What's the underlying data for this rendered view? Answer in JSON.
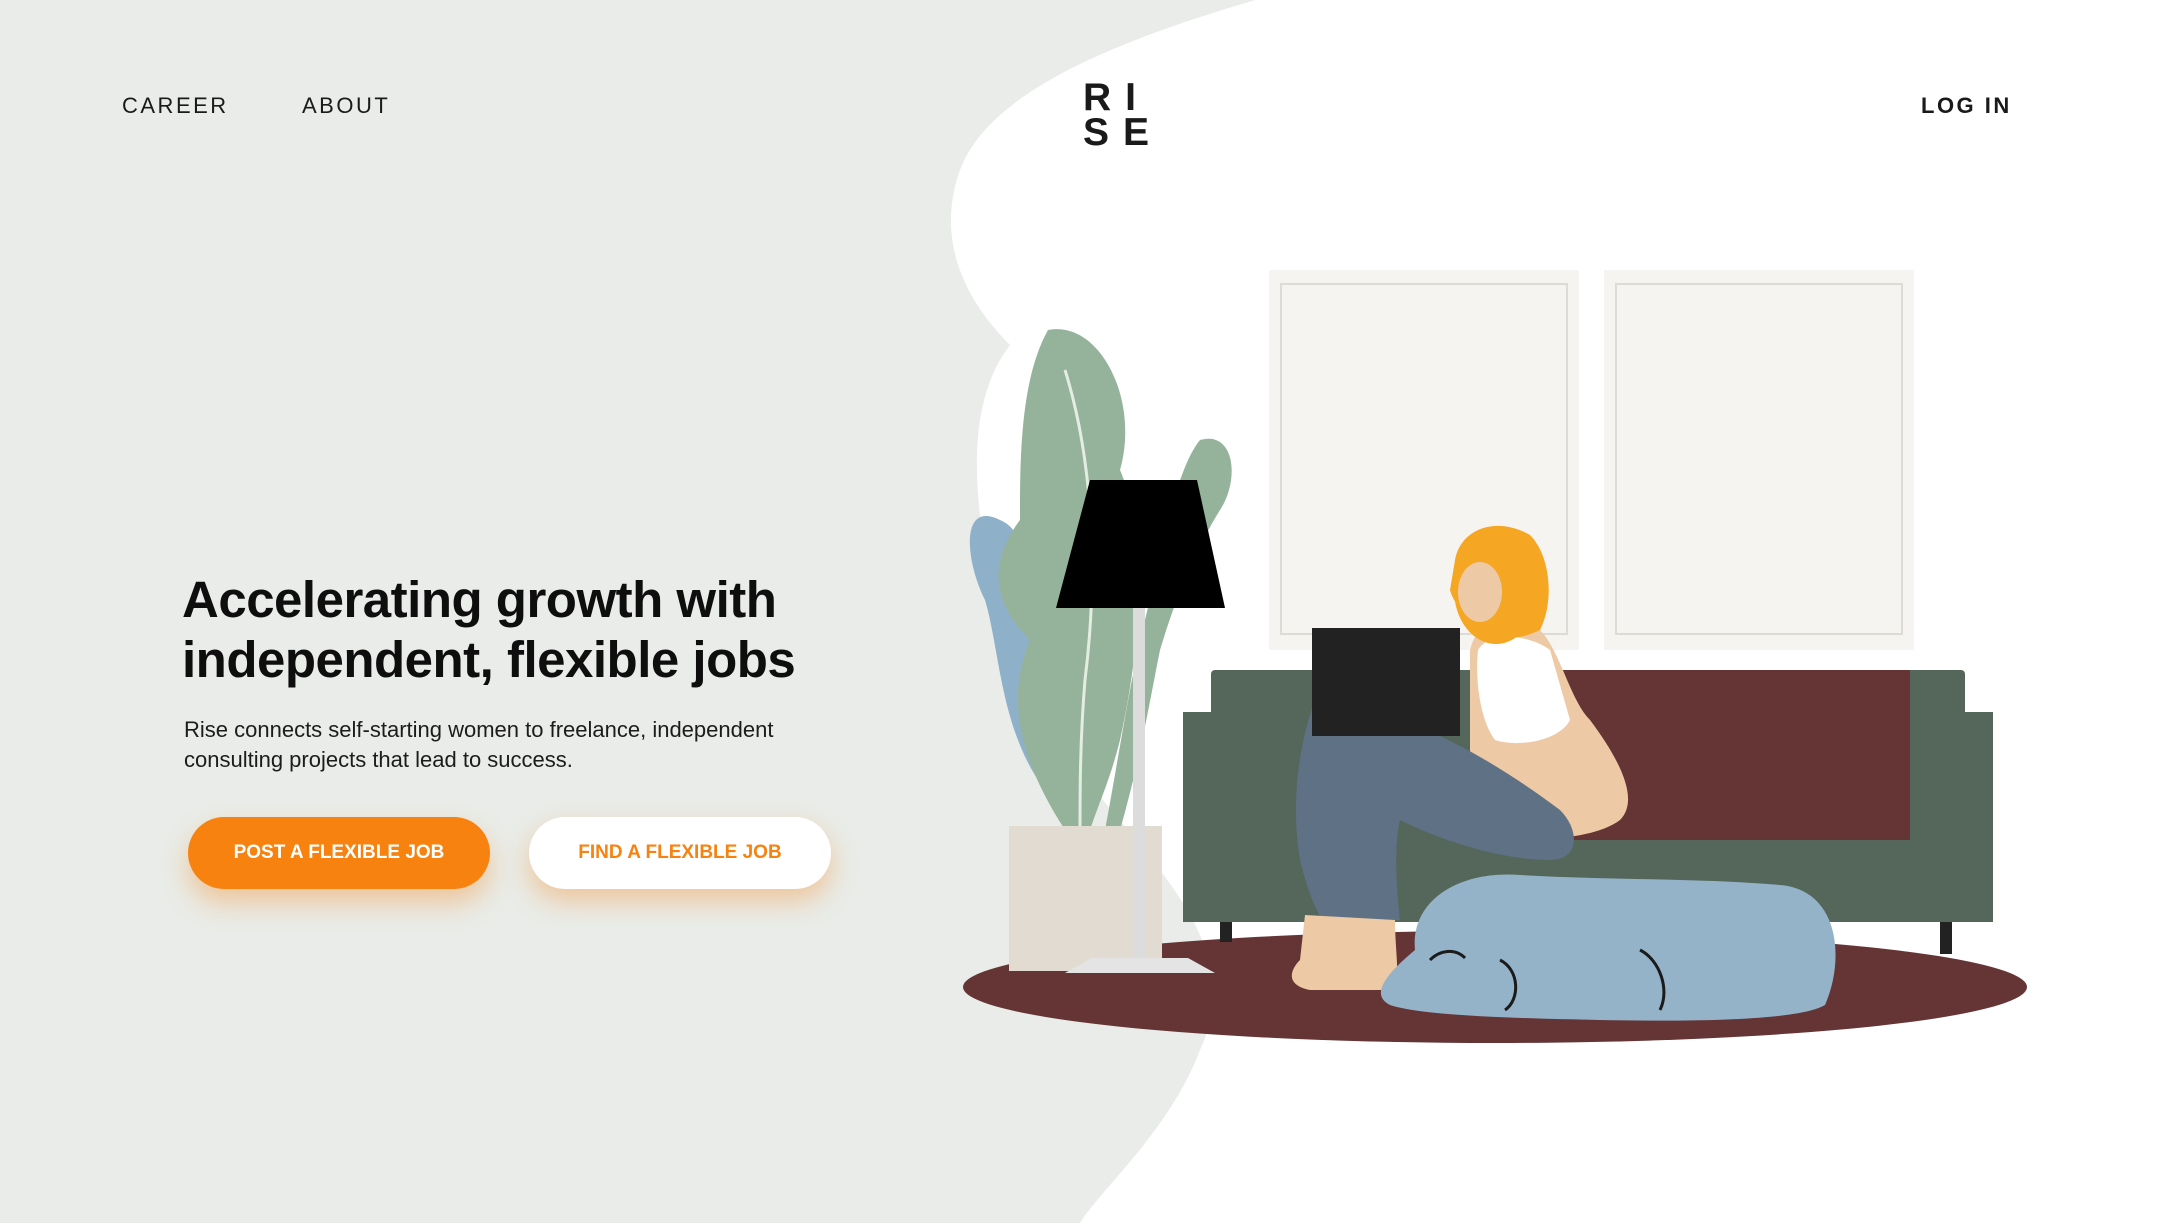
{
  "nav": {
    "career": "CAREER",
    "about": "ABOUT",
    "login": "LOG IN"
  },
  "logo": {
    "line1": "RI",
    "line2": "SE"
  },
  "hero": {
    "title_line1": "Accelerating growth with",
    "title_line2": "independent, flexible jobs",
    "subtitle_line1": "Rise connects self-starting women to freelance, independent",
    "subtitle_line2": "consulting projects that lead to success."
  },
  "buttons": {
    "post_job": "POST A FLEXIBLE JOB",
    "find_job": "FIND A FLEXIBLE JOB"
  },
  "colors": {
    "accent": "#f7820f",
    "background_blob": "#e9ece8",
    "sofa": "#55665a",
    "rug": "#653536",
    "dog": "#94b3c9",
    "hair": "#f5a623"
  },
  "illustration": {
    "icons": [
      "plant-icon",
      "floor-lamp-icon",
      "window-icon",
      "sofa-icon",
      "woman-with-laptop-icon",
      "dog-icon",
      "rug-icon"
    ]
  }
}
